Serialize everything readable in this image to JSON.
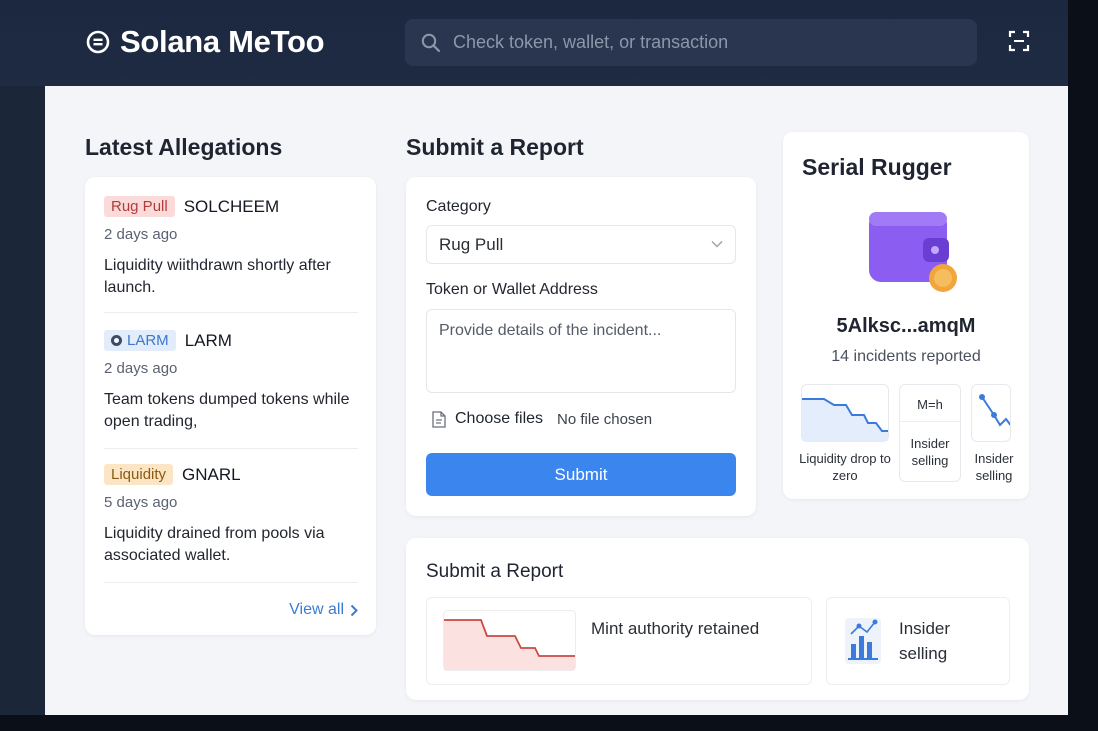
{
  "app": {
    "title": "Solana MeToo"
  },
  "search": {
    "placeholder": "Check token, wallet, or transaction"
  },
  "allegations": {
    "title": "Latest Allegations",
    "items": [
      {
        "badge": "Rug Pull",
        "token": "SOLCHEEM",
        "time": "2 days ago",
        "description": "Liquidity wiithdrawn shortly after launch."
      },
      {
        "badge": "LARM",
        "token": "LARM",
        "time": "2 days ago",
        "description": "Team tokens dumped tokens while open trading,"
      },
      {
        "badge": "Liquidity",
        "token": "GNARL",
        "time": "5 days ago",
        "description": "Liquidity drained from pools via associated wallet."
      }
    ],
    "view_all": "View all"
  },
  "report_form": {
    "title": "Submit a Report",
    "category_label": "Category",
    "category_value": "Rug Pull",
    "address_label": "Token or Wallet Address",
    "details_placeholder": "Provide details of the incident...",
    "choose_files": "Choose files",
    "no_file": "No file chosen",
    "submit": "Submit"
  },
  "serial_rugger": {
    "title": "Serial Rugger",
    "address": "5Alksc...amqM",
    "incidents": "14 incidents reported",
    "cards": [
      {
        "caption": "Liquidity drop to zero"
      },
      {
        "caption": "Insider selling",
        "chip": "M=h"
      },
      {
        "caption": "Insider selling"
      }
    ]
  },
  "report_bottom": {
    "title": "Submit a Report",
    "cards": [
      {
        "text": "Mint authority retained"
      },
      {
        "text": "Insider selling"
      }
    ]
  },
  "colors": {
    "accent": "#3b86ee",
    "header": "#1c2840",
    "wallet": "#7b4fe0",
    "coin": "#f0a63a"
  },
  "icons": {
    "logo": "circle-menu-icon",
    "search": "search-icon",
    "scan": "scan-icon",
    "file": "file-icon",
    "chevron": "chevron-down-icon",
    "wallet": "wallet-icon"
  }
}
